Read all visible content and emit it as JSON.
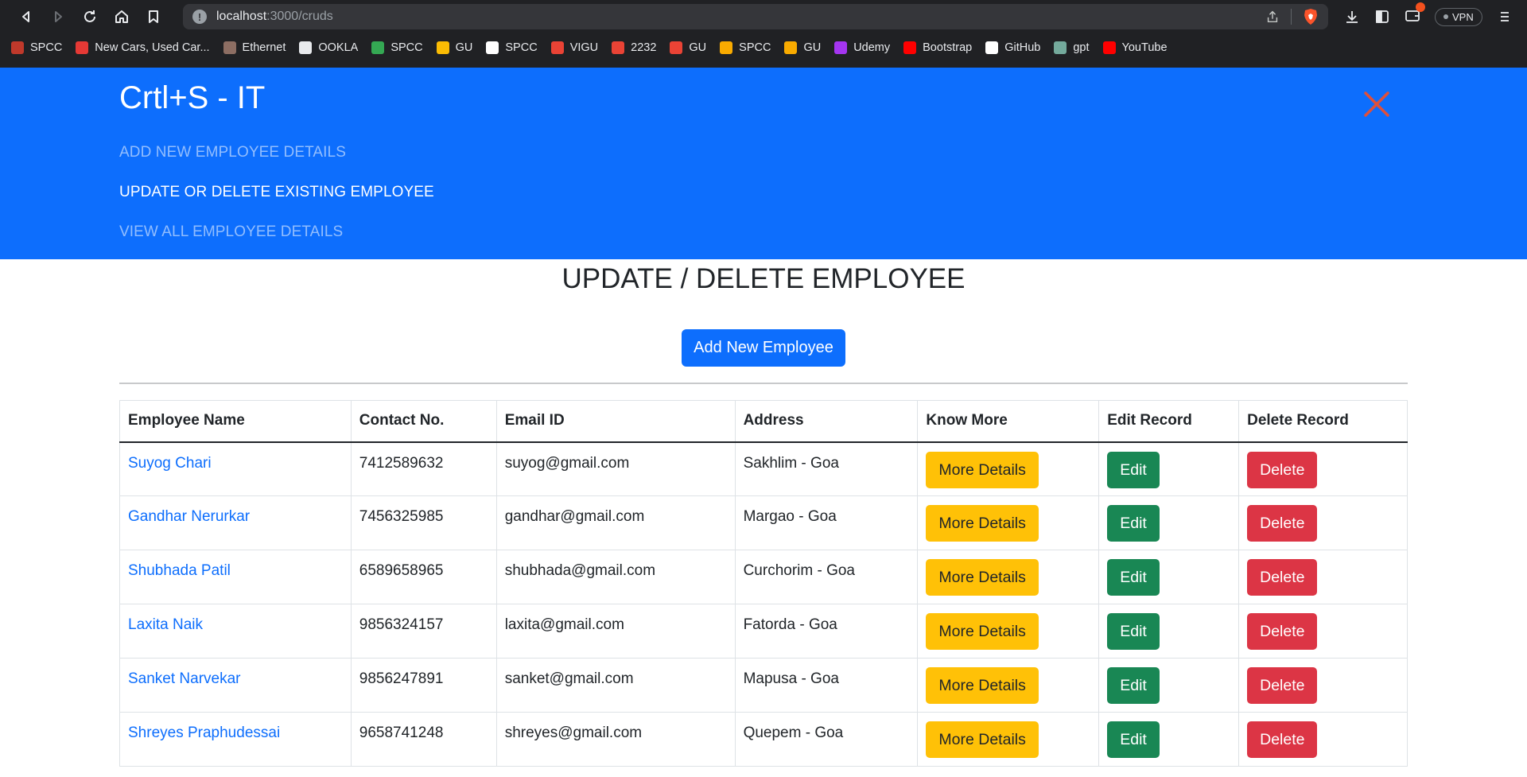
{
  "browser": {
    "url_host": "localhost",
    "url_path": ":3000/cruds",
    "vpn_label": "VPN",
    "bookmarks": [
      {
        "label": "SPCC",
        "color": "#c0392b"
      },
      {
        "label": "New Cars, Used Car...",
        "color": "#e53935"
      },
      {
        "label": "Ethernet",
        "color": "#8d6e63"
      },
      {
        "label": "OOKLA",
        "color": "#e8eaed"
      },
      {
        "label": "SPCC",
        "color": "#34a853"
      },
      {
        "label": "GU",
        "color": "#fbbc04"
      },
      {
        "label": "SPCC",
        "color": "#ffffff"
      },
      {
        "label": "VIGU",
        "color": "#ea4335"
      },
      {
        "label": "2232",
        "color": "#ea4335"
      },
      {
        "label": "GU",
        "color": "#ea4335"
      },
      {
        "label": "SPCC",
        "color": "#f9ab00"
      },
      {
        "label": "GU",
        "color": "#f9ab00"
      },
      {
        "label": "Udemy",
        "color": "#a435f0"
      },
      {
        "label": "Bootstrap",
        "color": "#ff0000"
      },
      {
        "label": "GitHub",
        "color": "#ffffff"
      },
      {
        "label": "gpt",
        "color": "#74aa9c"
      },
      {
        "label": "YouTube",
        "color": "#ff0000"
      }
    ]
  },
  "nav": {
    "brand": "Crtl+S - IT",
    "links": [
      {
        "label": "ADD NEW EMPLOYEE DETAILS",
        "active": false
      },
      {
        "label": "UPDATE OR DELETE EXISTING EMPLOYEE",
        "active": true
      },
      {
        "label": "VIEW ALL EMPLOYEE DETAILS",
        "active": false
      }
    ]
  },
  "main": {
    "title": "UPDATE / DELETE EMPLOYEE",
    "add_button": "Add New Employee"
  },
  "table": {
    "headers": [
      "Employee Name",
      "Contact No.",
      "Email ID",
      "Address",
      "Know More",
      "Edit Record",
      "Delete Record"
    ],
    "more_label": "More Details",
    "edit_label": "Edit",
    "delete_label": "Delete",
    "rows": [
      {
        "name": "Suyog Chari",
        "contact": "7412589632",
        "email": "suyog@gmail.com",
        "address": "Sakhlim - Goa"
      },
      {
        "name": "Gandhar Nerurkar",
        "contact": "7456325985",
        "email": "gandhar@gmail.com",
        "address": "Margao - Goa"
      },
      {
        "name": "Shubhada Patil",
        "contact": "6589658965",
        "email": "shubhada@gmail.com",
        "address": "Curchorim - Goa"
      },
      {
        "name": "Laxita Naik",
        "contact": "9856324157",
        "email": "laxita@gmail.com",
        "address": "Fatorda - Goa"
      },
      {
        "name": "Sanket Narvekar",
        "contact": "9856247891",
        "email": "sanket@gmail.com",
        "address": "Mapusa - Goa"
      },
      {
        "name": "Shreyes Praphudessai",
        "contact": "9658741248",
        "email": "shreyes@gmail.com",
        "address": "Quepem - Goa"
      }
    ]
  }
}
